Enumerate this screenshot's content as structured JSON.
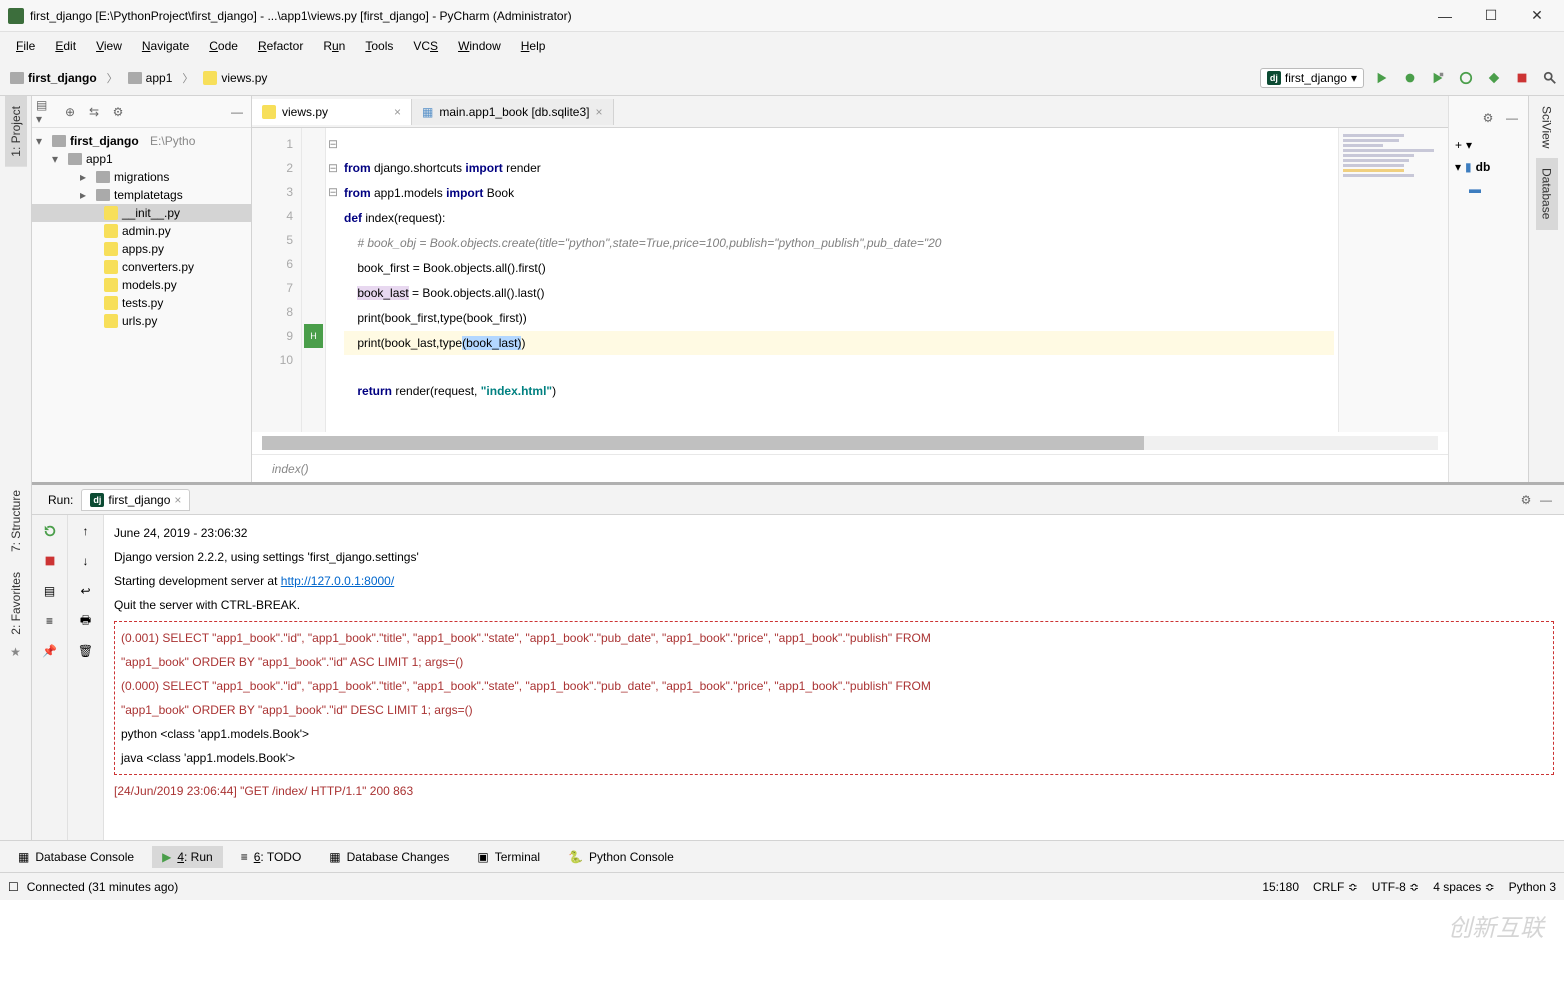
{
  "titlebar": {
    "text": "first_django [E:\\PythonProject\\first_django] - ...\\app1\\views.py [first_django] - PyCharm (Administrator)"
  },
  "menu": {
    "file": "File",
    "edit": "Edit",
    "view": "View",
    "navigate": "Navigate",
    "code": "Code",
    "refactor": "Refactor",
    "run": "Run",
    "tools": "Tools",
    "vcs": "VCS",
    "window": "Window",
    "help": "Help"
  },
  "breadcrumb": {
    "root": "first_django",
    "pkg": "app1",
    "file": "views.py"
  },
  "run_config": "first_django",
  "tabs": {
    "t1": "views.py",
    "t2": "main.app1_book [db.sqlite3]"
  },
  "left_tabs": {
    "project": "1: Project",
    "structure": "7: Structure",
    "favorites": "2: Favorites"
  },
  "right_tabs": {
    "sciview": "SciView",
    "database": "Database"
  },
  "right_panel": {
    "db": "db"
  },
  "tree": {
    "root": "first_django",
    "root_path": "E:\\Pytho",
    "app1": "app1",
    "migrations": "migrations",
    "templatetags": "templatetags",
    "init": "__init__.py",
    "admin": "admin.py",
    "apps": "apps.py",
    "converters": "converters.py",
    "models": "models.py",
    "tests": "tests.py",
    "urls": "urls.py"
  },
  "code": {
    "l1a": "from",
    "l1b": " django.shortcuts ",
    "l1c": "import",
    "l1d": " render",
    "l2a": "from",
    "l2b": " app1.models ",
    "l2c": "import",
    "l2d": " Book",
    "l3a": "def ",
    "l3b": "index",
    "l3c": "(request):",
    "l4": "    # book_obj = Book.objects.create(title=\"python\",state=True,price=100,publish=\"python_publish\",pub_date=\"20",
    "l5": "    book_first = Book.objects.all().first()",
    "l6a": "    ",
    "l6b": "book_last",
    "l6c": " = Book.objects.all().last()",
    "l7a": "    print(book_first,",
    "l7b": "type",
    "l7c": "(book_first))",
    "l8a": "    print(book_last,",
    "l8b": "type",
    "l8c": "(book_last)",
    "l8d": ")",
    "l9a": "    ",
    "l9b": "return",
    "l9c": " render(request, ",
    "l9d": "\"index.html\"",
    "l9e": ")"
  },
  "line_numbers": [
    "1",
    "2",
    "3",
    "4",
    "5",
    "6",
    "7",
    "8",
    "9",
    "10"
  ],
  "breadcrumb_fn": "index()",
  "run": {
    "label": "Run:",
    "tab": "first_django",
    "date": "June 24, 2019 - 23:06:32",
    "version": "Django version 2.2.2, using settings 'first_django.settings'",
    "starting": "Starting development server at ",
    "url": "http://127.0.0.1:8000/",
    "quit": "Quit the server with CTRL-BREAK.",
    "sql1": "(0.001) SELECT \"app1_book\".\"id\", \"app1_book\".\"title\", \"app1_book\".\"state\", \"app1_book\".\"pub_date\", \"app1_book\".\"price\", \"app1_book\".\"publish\" FROM ",
    "sql1b": "\"app1_book\" ORDER BY \"app1_book\".\"id\" ASC  LIMIT 1; args=()",
    "sql2": "(0.000) SELECT \"app1_book\".\"id\", \"app1_book\".\"title\", \"app1_book\".\"state\", \"app1_book\".\"pub_date\", \"app1_book\".\"price\", \"app1_book\".\"publish\" FROM",
    "sql2b": " \"app1_book\" ORDER BY \"app1_book\".\"id\" DESC  LIMIT 1; args=()",
    "out1": "python <class 'app1.models.Book'>",
    "out2": "java <class 'app1.models.Book'>",
    "http": "[24/Jun/2019 23:06:44] \"GET /index/ HTTP/1.1\" 200 863"
  },
  "bottom": {
    "db": "Database Console",
    "run": "4: Run",
    "todo": "6: TODO",
    "dbc": "Database Changes",
    "term": "Terminal",
    "pycon": "Python Console"
  },
  "status": {
    "conn": "Connected (31 minutes ago)",
    "pos": "15:180",
    "crlf": "CRLF",
    "enc": "UTF-8",
    "indent": "4 spaces",
    "py": "Python 3"
  }
}
